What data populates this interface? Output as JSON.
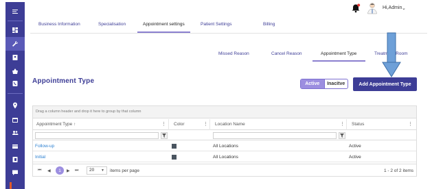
{
  "header": {
    "user_name": "Hi,Admin",
    "user_chevron": "⌄"
  },
  "main_tabs": [
    {
      "label": "Business Information"
    },
    {
      "label": "Specialisation"
    },
    {
      "label": "Appointment settings"
    },
    {
      "label": "Patient Settings"
    },
    {
      "label": "Billing"
    }
  ],
  "sub_tabs": [
    {
      "label": "Missed Reason"
    },
    {
      "label": "Cancel Reason"
    },
    {
      "label": "Appointment Type"
    },
    {
      "label": "Treatment Room"
    }
  ],
  "section": {
    "title": "Appointment Type",
    "toggle_active": "Active",
    "toggle_inactive": "Inacitve",
    "add_button": "Add Appointment Type"
  },
  "grid": {
    "group_hint": "Drag a column header and drop it here to group by that column",
    "columns": [
      {
        "label": "Appointment Type",
        "sort": "↑"
      },
      {
        "label": "Color"
      },
      {
        "label": "Location Name"
      },
      {
        "label": "Status"
      }
    ],
    "rows": [
      {
        "type": "Follow-up",
        "location": "All Locations",
        "status": "Active"
      },
      {
        "type": "Initial",
        "location": "All Locations",
        "status": "Active"
      }
    ],
    "pager": {
      "first": "⏮",
      "prev": "◀",
      "current_page": "1",
      "next": "▶",
      "last": "⏭",
      "page_size": "20",
      "page_size_label": "items per page",
      "info": "1 - 2 of 2 items"
    }
  },
  "colors": {
    "sidebar": "#3d3d96",
    "accent": "#9c8ee0",
    "link": "#2a7fd0",
    "arrow": "#6ea0d8"
  }
}
